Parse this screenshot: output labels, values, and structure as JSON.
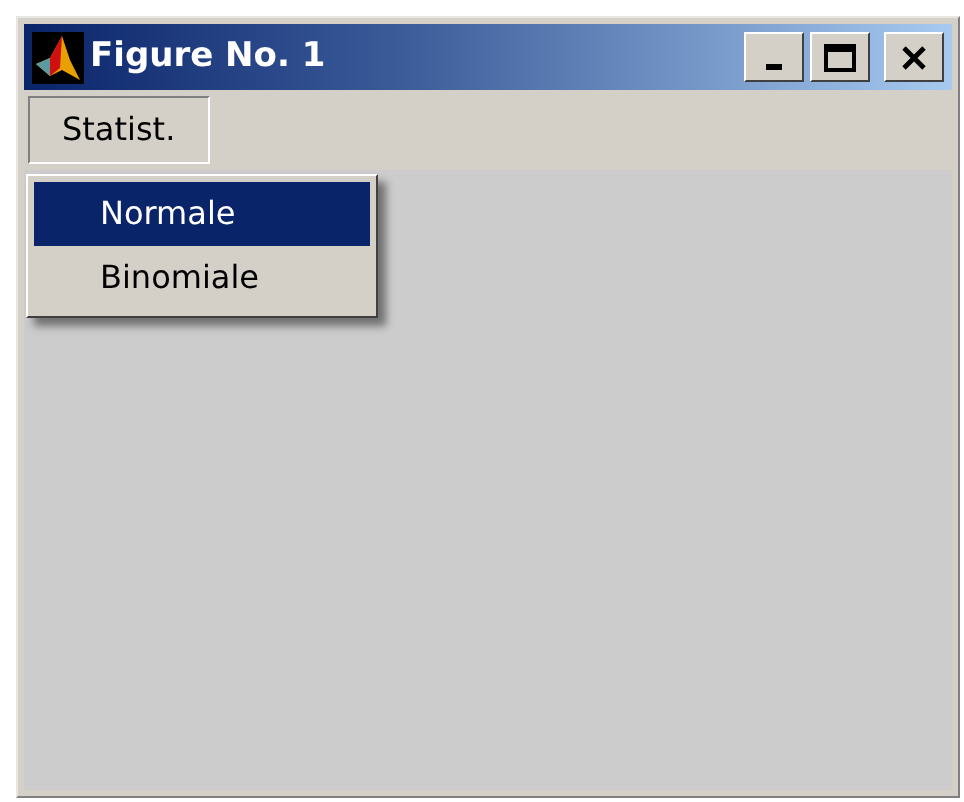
{
  "window": {
    "title": "Figure No. 1"
  },
  "menu_bar": [
    {
      "label": "Statist.",
      "expanded": true
    }
  ],
  "dropdown": [
    {
      "label": "Normale",
      "selected": true
    },
    {
      "label": "Binomiale",
      "selected": false
    }
  ]
}
